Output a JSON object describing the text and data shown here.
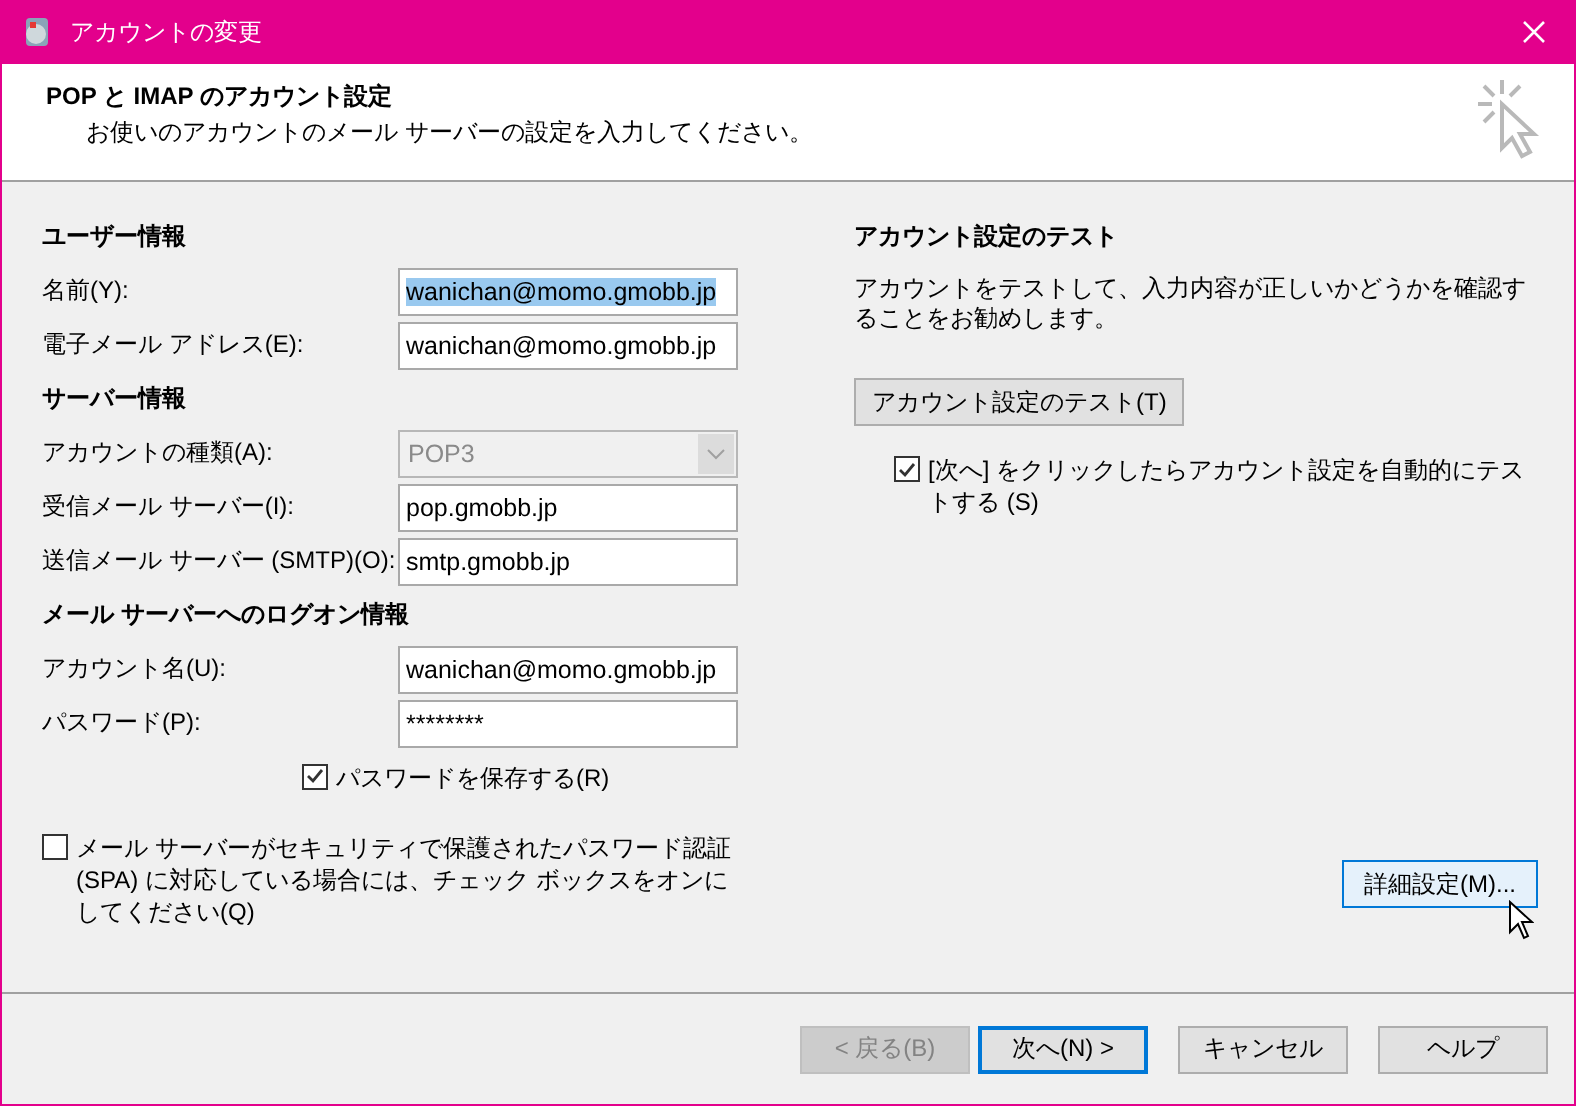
{
  "window": {
    "title": "アカウントの変更"
  },
  "header": {
    "title": "POP と IMAP のアカウント設定",
    "subtitle": "お使いのアカウントのメール サーバーの設定を入力してください。"
  },
  "left_sections": [
    {
      "heading": "ユーザー情報",
      "rows": [
        {
          "kind": "field",
          "label": "名前(Y):",
          "value": "wanichan@momo.gmobb.jp",
          "selected": true
        },
        {
          "kind": "field",
          "label": "電子メール アドレス(E):",
          "value": "wanichan@momo.gmobb.jp",
          "selected": false
        }
      ]
    },
    {
      "heading": "サーバー情報",
      "rows": [
        {
          "kind": "dropdown",
          "label": "アカウントの種類(A):",
          "value": "POP3",
          "disabled": true
        },
        {
          "kind": "field",
          "label": "受信メール サーバー(I):",
          "value": "pop.gmobb.jp",
          "selected": false
        },
        {
          "kind": "field",
          "label": "送信メール サーバー (SMTP)(O):",
          "value": "smtp.gmobb.jp",
          "selected": false
        }
      ]
    },
    {
      "heading": "メール サーバーへのログオン情報",
      "rows": [
        {
          "kind": "field",
          "label": "アカウント名(U):",
          "value": "wanichan@momo.gmobb.jp",
          "selected": false
        },
        {
          "kind": "field",
          "label": "パスワード(P):",
          "value": "********",
          "selected": false
        },
        {
          "kind": "checkbox",
          "label": "パスワードを保存する(R)",
          "checked": true
        }
      ]
    }
  ],
  "spa_checkbox": {
    "label": "メール サーバーがセキュリティで保護されたパスワード認証 (SPA) に対応している場合には、チェック ボックスをオンにしてください(Q)",
    "checked": false
  },
  "test": {
    "heading": "アカウント設定のテスト",
    "description": "アカウントをテストして、入力内容が正しいかどうかを確認することをお勧めします。",
    "button": "アカウント設定のテスト(T)",
    "auto_checkbox": {
      "label": "[次へ] をクリックしたらアカウント設定を自動的にテストする (S)",
      "checked": true
    }
  },
  "advanced_button": {
    "label": "詳細設定(M)...",
    "hovered": true
  },
  "footer_buttons": [
    {
      "label": "< 戻る(B)",
      "disabled": true,
      "default": false
    },
    {
      "label": "次へ(N) >",
      "disabled": false,
      "default": true
    },
    {
      "label": "キャンセル",
      "disabled": false,
      "default": false
    },
    {
      "label": "ヘルプ",
      "disabled": false,
      "default": false
    }
  ]
}
